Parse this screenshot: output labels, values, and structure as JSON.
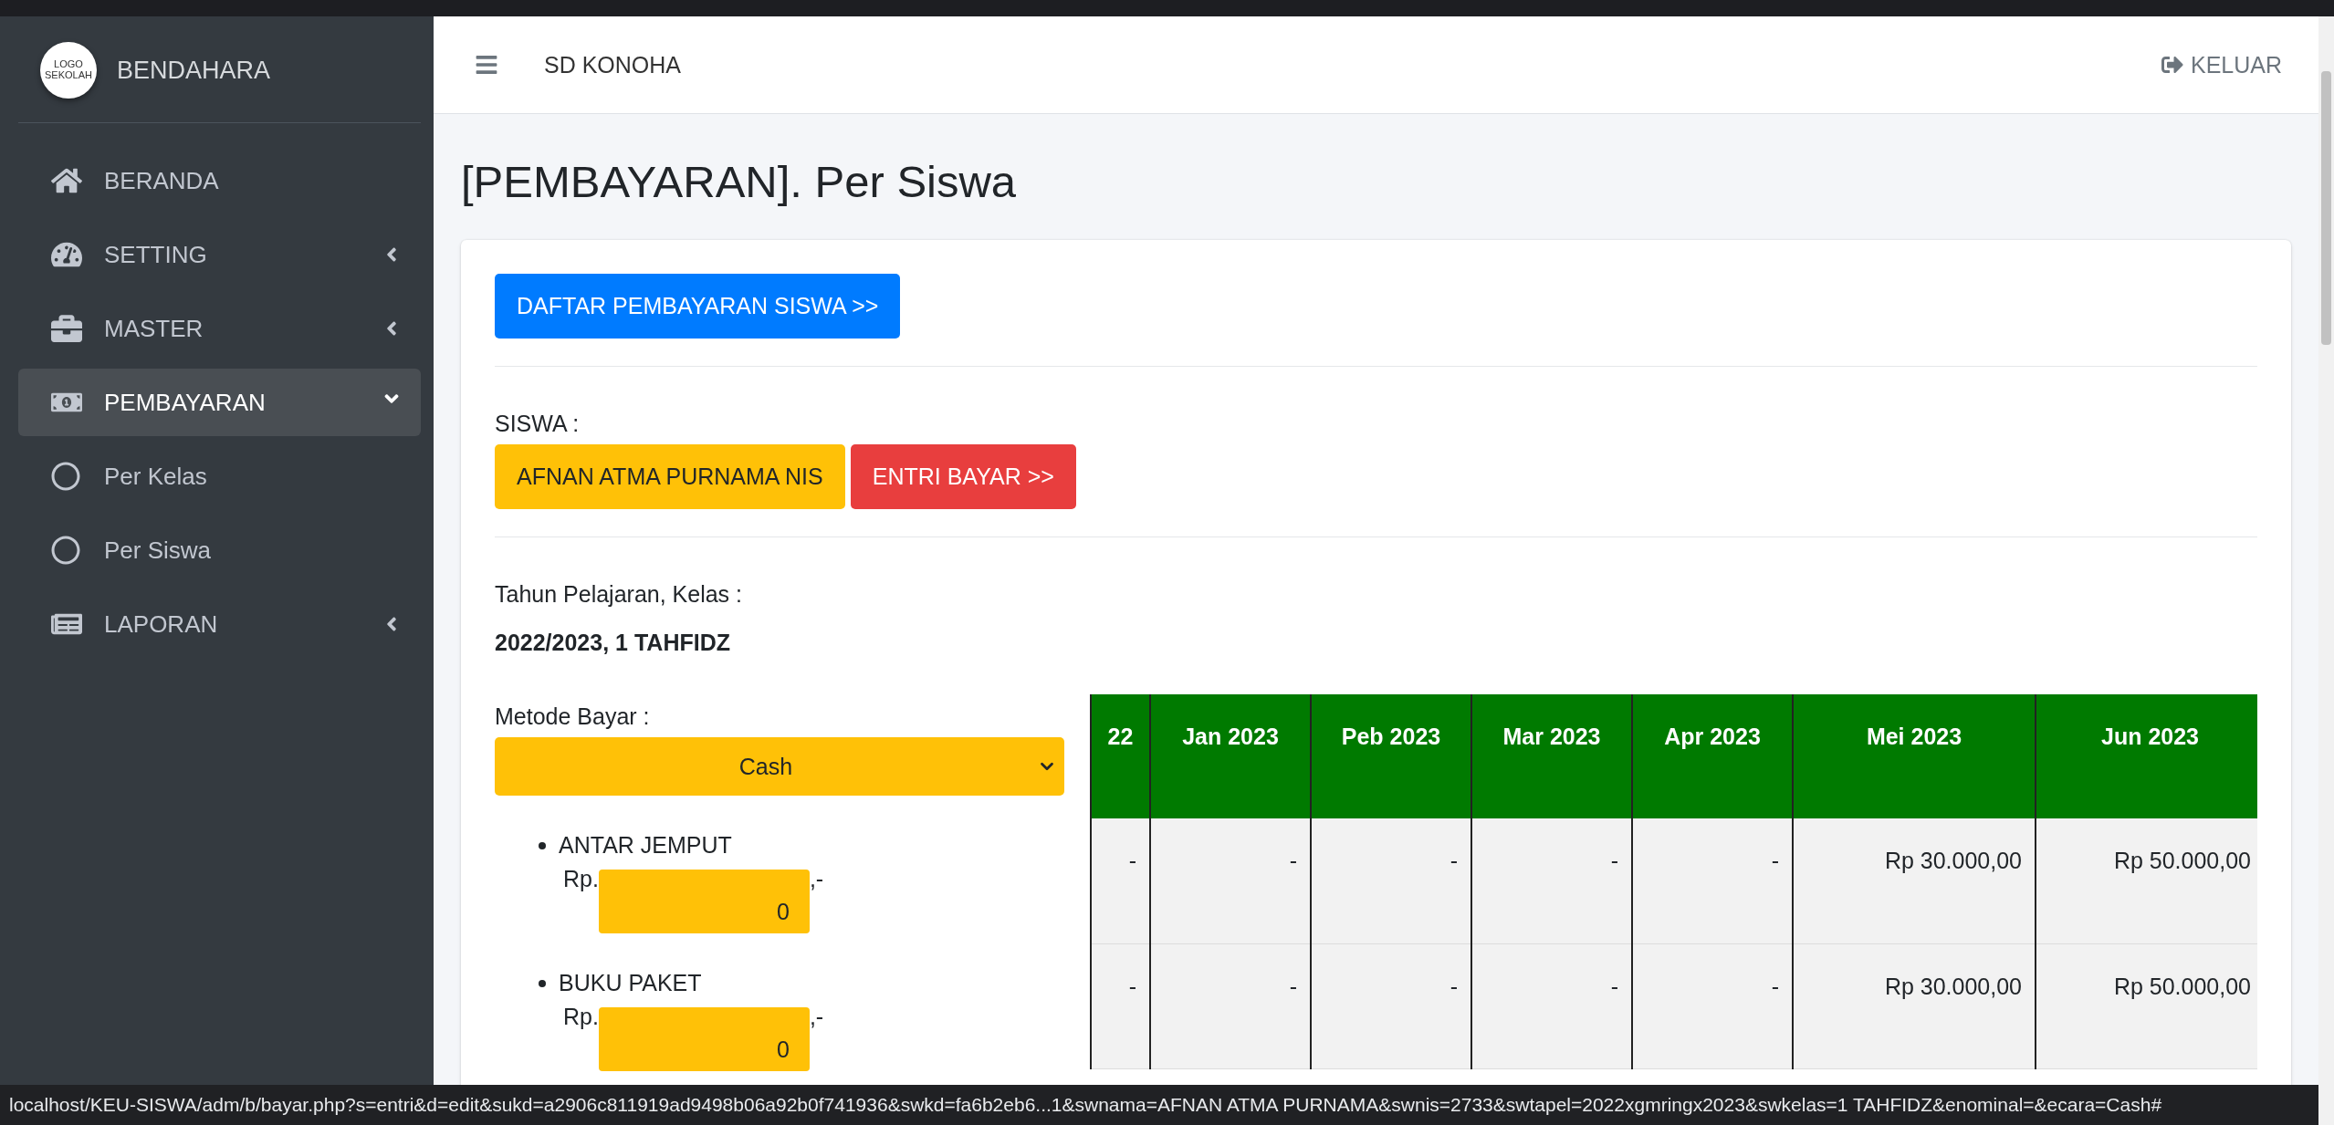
{
  "sidebar": {
    "brand": {
      "logo_text": "LOGO SEKOLAH",
      "title": "BENDAHARA"
    },
    "items": [
      {
        "label": "BERANDA",
        "selected": false
      },
      {
        "label": "SETTING",
        "expanded": false,
        "selected": false
      },
      {
        "label": "MASTER",
        "expanded": false,
        "selected": false
      },
      {
        "label": "PEMBAYARAN",
        "expanded": true,
        "selected": true,
        "children": [
          {
            "label": "Per Kelas",
            "selected": false
          },
          {
            "label": "Per Siswa",
            "selected": false
          }
        ]
      },
      {
        "label": "LAPORAN",
        "expanded": false,
        "selected": false
      }
    ]
  },
  "header": {
    "school": "SD KONOHA",
    "logout": "KELUAR"
  },
  "page_title": "[PEMBAYARAN]. Per Siswa",
  "card": {
    "list_button": "DAFTAR PEMBAYARAN SISWA >>",
    "student_label": "SISWA :",
    "student_button": "AFNAN ATMA PURNAMA NIS",
    "entry_button": "ENTRI BAYAR >>",
    "year_class_label": "Tahun Pelajaran, Kelas :",
    "year_class_value": "2022/2023, 1 TAHFIDZ",
    "method_label": "Metode Bayar :",
    "method_value": "Cash",
    "payments": [
      {
        "name": "ANTAR JEMPUT",
        "prefix": "Rp.",
        "value": "0",
        "suffix": ",-"
      },
      {
        "name": "BUKU PAKET",
        "prefix": "Rp.",
        "value": "0",
        "suffix": ",-"
      }
    ]
  },
  "table": {
    "columns": [
      "22",
      "Jan 2023",
      "Peb 2023",
      "Mar 2023",
      "Apr 2023",
      "Mei 2023",
      "Jun 2023"
    ],
    "rows": [
      {
        "cells": [
          "-",
          "-",
          "-",
          "-",
          "-",
          "Rp 30.000,00",
          "Rp 50.000,00"
        ]
      },
      {
        "cells": [
          "-",
          "-",
          "-",
          "-",
          "-",
          "Rp 30.000,00",
          "Rp 50.000,00"
        ]
      }
    ]
  },
  "status_bar": "localhost/KEU-SISWA/adm/b/bayar.php?s=entri&d=edit&sukd=a2906c811919ad9498b06a92b0f741936&swkd=fa6b2eb6...1&swnama=AFNAN ATMA PURNAMA&swnis=2733&swtapel=2022xgmringx2023&swkelas=1 TAHFIDZ&enominal=&ecara=Cash#"
}
